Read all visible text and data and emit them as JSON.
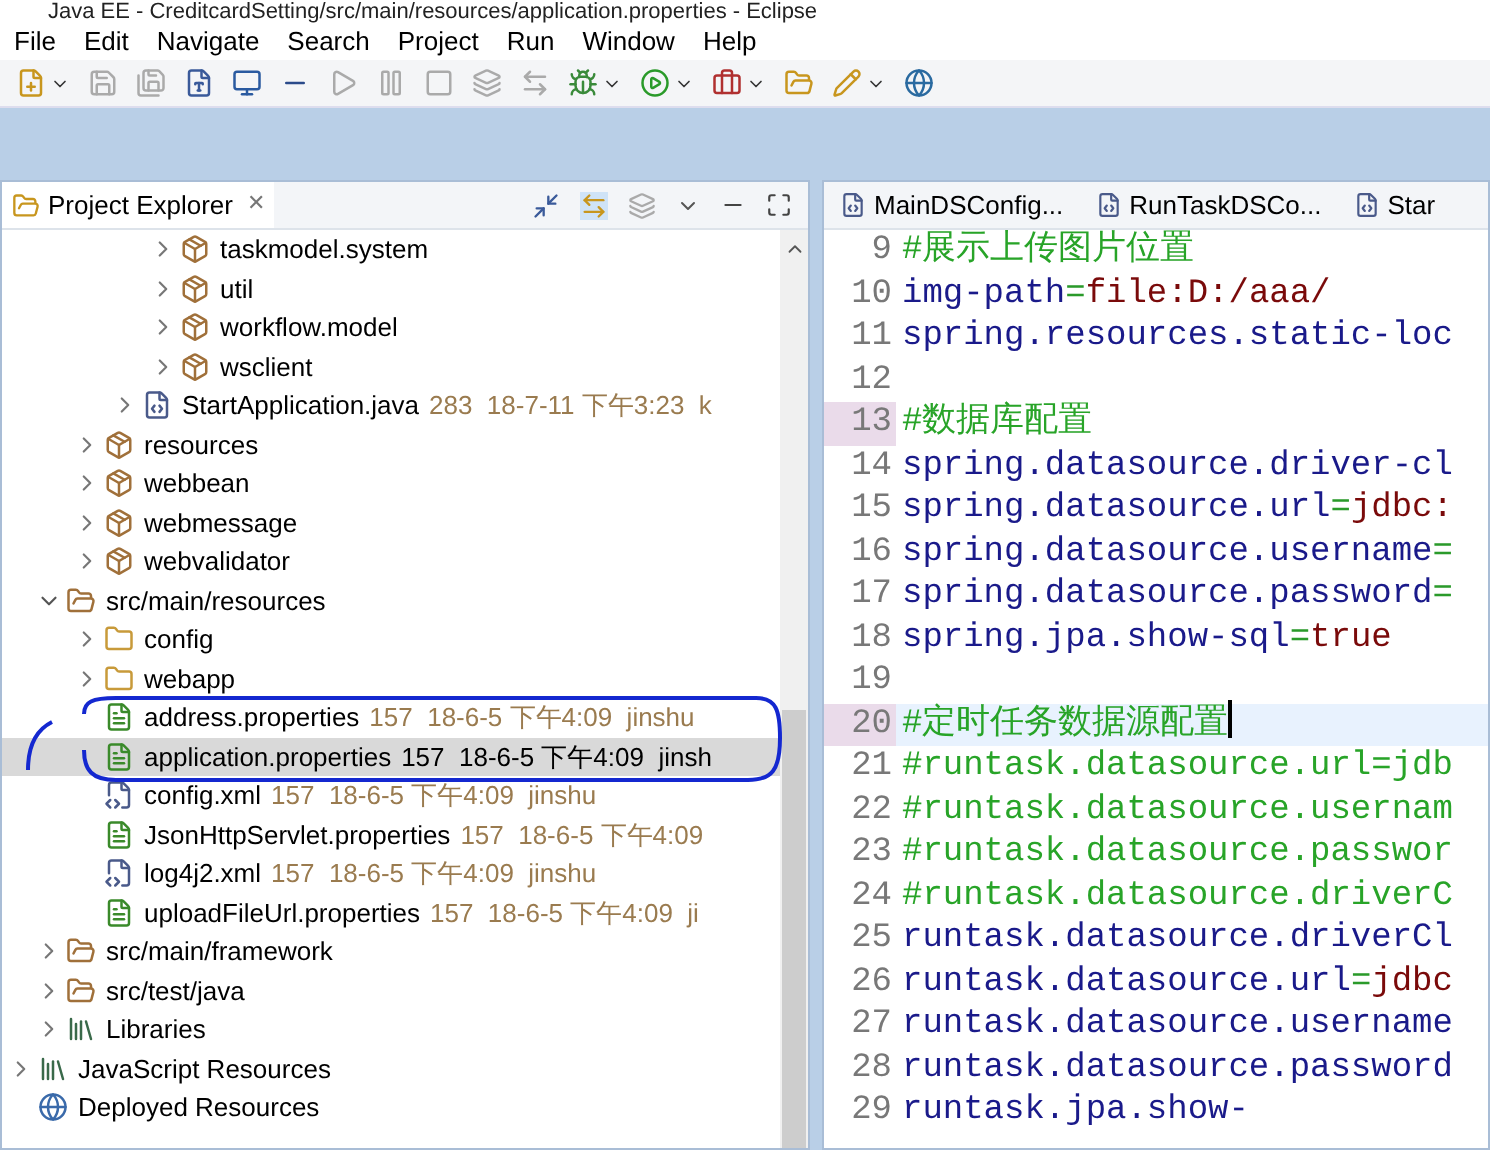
{
  "window": {
    "title": "Java EE - CreditcardSetting/src/main/resources/application.properties - Eclipse"
  },
  "menu": [
    "File",
    "Edit",
    "Navigate",
    "Search",
    "Project",
    "Run",
    "Window",
    "Help"
  ],
  "explorer": {
    "title": "Project Explorer",
    "close": "✕",
    "tree": [
      {
        "children": [
          {
            "children": [
              {
                "children": [
                  {
                    "children": [
                      {
                        "children": [
                          {
                            "label": "taskmodel.system",
                            "kind": "package",
                            "expanded": false,
                            "selected": false
                          },
                          {
                            "label": "util",
                            "kind": "package",
                            "expanded": false,
                            "selected": false
                          },
                          {
                            "label": "workflow.model",
                            "kind": "package",
                            "expanded": false,
                            "selected": false
                          },
                          {
                            "label": "wsclient",
                            "kind": "package",
                            "expanded": false,
                            "selected": false
                          }
                        ]
                      },
                      {
                        "label": "StartApplication.java",
                        "kind": "java",
                        "decoration": "283  18-7-11 下午3:23  k",
                        "expanded": false,
                        "selected": false
                      }
                    ]
                  },
                  {
                    "label": "resources",
                    "kind": "package",
                    "expanded": false,
                    "selected": false
                  },
                  {
                    "label": "webbean",
                    "kind": "package",
                    "expanded": false,
                    "selected": false
                  },
                  {
                    "label": "webmessage",
                    "kind": "package",
                    "expanded": false,
                    "selected": false
                  },
                  {
                    "label": "webvalidator",
                    "kind": "package",
                    "expanded": false,
                    "selected": false
                  }
                ]
              },
              {
                "label": "src/main/resources",
                "kind": "source-folder",
                "expanded": true,
                "selected": false,
                "children": [
                  {
                    "label": "config",
                    "kind": "folder",
                    "expanded": false,
                    "selected": false
                  },
                  {
                    "label": "webapp",
                    "kind": "folder",
                    "expanded": false,
                    "selected": false
                  },
                  {
                    "label": "address.properties",
                    "kind": "properties",
                    "decoration": "157  18-6-5 下午4:09  jinshu",
                    "selected": false
                  },
                  {
                    "label": "application.properties",
                    "kind": "properties",
                    "decoration": "157  18-6-5 下午4:09  jinsh",
                    "selected": true
                  },
                  {
                    "label": "config.xml",
                    "kind": "xml",
                    "decoration": "157  18-6-5 下午4:09  jinshu",
                    "selected": false
                  },
                  {
                    "label": "JsonHttpServlet.properties",
                    "kind": "properties",
                    "decoration": "157  18-6-5 下午4:09",
                    "selected": false
                  },
                  {
                    "label": "log4j2.xml",
                    "kind": "xml",
                    "decoration": "157  18-6-5 下午4:09  jinshu",
                    "selected": false
                  },
                  {
                    "label": "uploadFileUrl.properties",
                    "kind": "properties",
                    "decoration": "157  18-6-5 下午4:09  ji",
                    "selected": false
                  }
                ]
              },
              {
                "label": "src/main/framework",
                "kind": "source-folder",
                "expanded": false,
                "selected": false
              },
              {
                "label": "src/test/java",
                "kind": "source-folder",
                "expanded": false,
                "selected": false
              },
              {
                "label": "Libraries",
                "kind": "library",
                "expanded": false,
                "selected": false
              }
            ]
          },
          {
            "label": "JavaScript Resources",
            "kind": "library",
            "expanded": false,
            "selected": false
          },
          {
            "label": "Deployed Resources",
            "kind": "deployed",
            "selected": false
          }
        ]
      }
    ]
  },
  "editor": {
    "tabs": [
      {
        "label": "MainDSConfig...",
        "selected": false
      },
      {
        "label": "RunTaskDSCo...",
        "selected": false
      },
      {
        "label": "Star",
        "selected": false
      }
    ],
    "lines": [
      {
        "number": "9",
        "marked": false,
        "current": false,
        "segments": [
          {
            "kind": "comment",
            "text": "#展示上传图片位置"
          }
        ]
      },
      {
        "number": "10",
        "marked": false,
        "current": false,
        "segments": [
          {
            "kind": "key",
            "text": "img-path"
          },
          {
            "kind": "op",
            "text": "="
          },
          {
            "kind": "value",
            "text": "file:D:/aaa/"
          }
        ]
      },
      {
        "number": "11",
        "marked": false,
        "current": false,
        "segments": [
          {
            "kind": "key",
            "text": "spring.resources.static-loc"
          }
        ]
      },
      {
        "number": "12",
        "marked": false,
        "current": false
      },
      {
        "number": "13",
        "marked": true,
        "current": false,
        "segments": [
          {
            "kind": "comment",
            "text": "#数据库配置"
          }
        ]
      },
      {
        "number": "14",
        "marked": false,
        "current": false,
        "segments": [
          {
            "kind": "key",
            "text": "spring.datasource.driver-cl"
          }
        ]
      },
      {
        "number": "15",
        "marked": false,
        "current": false,
        "segments": [
          {
            "kind": "key",
            "text": "spring.datasource.url"
          },
          {
            "kind": "op",
            "text": "="
          },
          {
            "kind": "value",
            "text": "jdbc:"
          }
        ]
      },
      {
        "number": "16",
        "marked": false,
        "current": false,
        "segments": [
          {
            "kind": "key",
            "text": "spring.datasource.username"
          },
          {
            "kind": "op",
            "text": "="
          }
        ]
      },
      {
        "number": "17",
        "marked": false,
        "current": false,
        "segments": [
          {
            "kind": "key",
            "text": "spring.datasource.password"
          },
          {
            "kind": "op",
            "text": "="
          }
        ]
      },
      {
        "number": "18",
        "marked": false,
        "current": false,
        "segments": [
          {
            "kind": "key",
            "text": "spring.jpa.show-sql"
          },
          {
            "kind": "op",
            "text": "="
          },
          {
            "kind": "value",
            "text": "true"
          }
        ]
      },
      {
        "number": "19",
        "marked": false,
        "current": false
      },
      {
        "number": "20",
        "marked": true,
        "current": true,
        "segments": [
          {
            "kind": "comment",
            "text": "#定时任务数据源配置"
          }
        ]
      },
      {
        "number": "21",
        "marked": false,
        "current": false,
        "segments": [
          {
            "kind": "comment",
            "text": "#runtask.datasource.url=jdb"
          }
        ]
      },
      {
        "number": "22",
        "marked": false,
        "current": false,
        "segments": [
          {
            "kind": "comment",
            "text": "#runtask.datasource.usernam"
          }
        ]
      },
      {
        "number": "23",
        "marked": false,
        "current": false,
        "segments": [
          {
            "kind": "comment",
            "text": "#runtask.datasource.passwor"
          }
        ]
      },
      {
        "number": "24",
        "marked": false,
        "current": false,
        "segments": [
          {
            "kind": "comment",
            "text": "#runtask.datasource.driverC"
          }
        ]
      },
      {
        "number": "25",
        "marked": false,
        "current": false,
        "segments": [
          {
            "kind": "key",
            "text": "runtask.datasource.driverCl"
          }
        ]
      },
      {
        "number": "26",
        "marked": false,
        "current": false,
        "segments": [
          {
            "kind": "key",
            "text": "runtask.datasource.url"
          },
          {
            "kind": "op",
            "text": "="
          },
          {
            "kind": "value",
            "text": "jdbc"
          }
        ]
      },
      {
        "number": "27",
        "marked": false,
        "current": false,
        "segments": [
          {
            "kind": "key",
            "text": "runtask.datasource.username"
          }
        ]
      },
      {
        "number": "28",
        "marked": false,
        "current": false,
        "segments": [
          {
            "kind": "key",
            "text": "runtask.datasource.password"
          }
        ]
      },
      {
        "number": "29",
        "marked": false,
        "current": false,
        "segments": [
          {
            "kind": "key",
            "text": "runtask.jpa.show-"
          }
        ]
      }
    ]
  }
}
